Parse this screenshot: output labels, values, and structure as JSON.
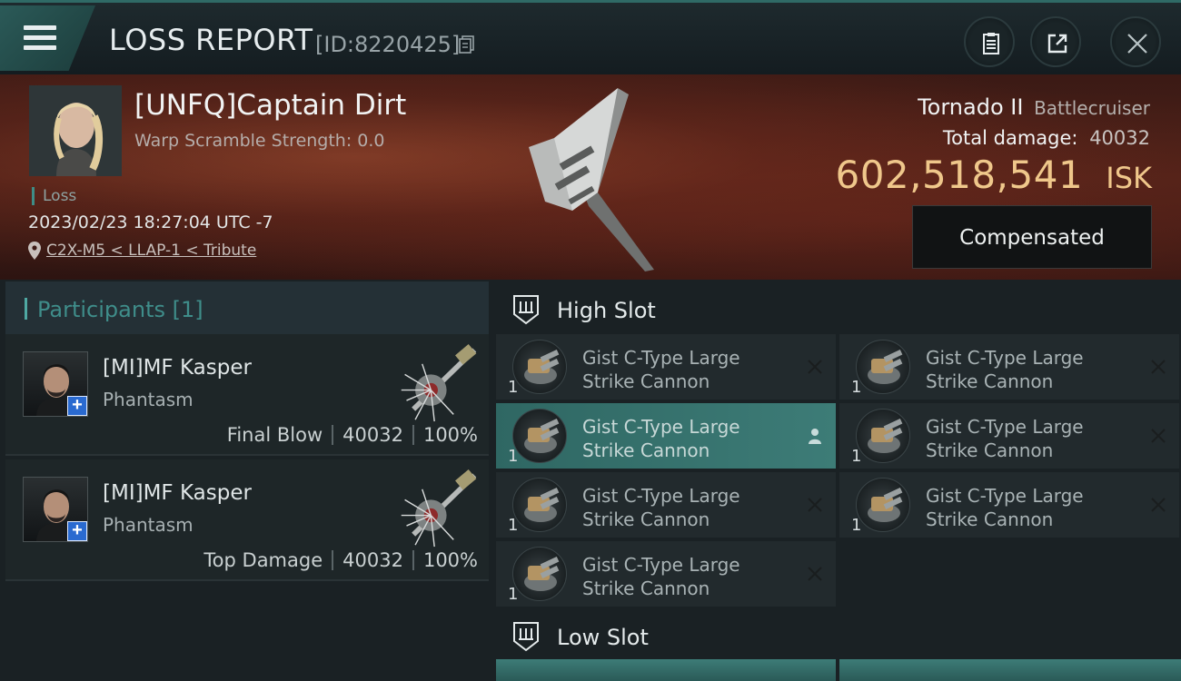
{
  "header": {
    "title": "LOSS REPORT",
    "report_id": "[ID:8220425]",
    "icons": [
      "menu-icon",
      "copy-icon",
      "clipboard-icon",
      "share-icon",
      "close-icon"
    ]
  },
  "victim": {
    "pilot_name": "[UNFQ]Captain Dirt",
    "warp_scramble": "Warp Scramble Strength: 0.0",
    "result_tag": "Loss",
    "datetime": "2023/02/23 18:27:04 UTC -7",
    "location": "C2X-M5 < LLAP-1 < Tribute",
    "ship_name": "Tornado II",
    "ship_class": "Battlecruiser",
    "total_damage_label": "Total damage:",
    "total_damage_value": "40032",
    "isk_amount": "602,518,541",
    "isk_unit": "ISK",
    "compensated_label": "Compensated"
  },
  "participants": {
    "header": "Participants [1]",
    "rows": [
      {
        "name": "[MI]MF Kasper",
        "ship": "Phantasm",
        "role": "Final Blow",
        "damage": "40032",
        "percent": "100%"
      },
      {
        "name": "[MI]MF Kasper",
        "ship": "Phantasm",
        "role": "Top Damage",
        "damage": "40032",
        "percent": "100%"
      }
    ]
  },
  "slots": {
    "high": {
      "label": "High Slot",
      "modules": [
        {
          "name": "Gist C-Type Large Strike Cannon",
          "qty": "1",
          "status": "destroyed"
        },
        {
          "name": "Gist C-Type Large Strike Cannon",
          "qty": "1",
          "status": "dropped"
        },
        {
          "name": "Gist C-Type Large Strike Cannon",
          "qty": "1",
          "status": "destroyed"
        },
        {
          "name": "Gist C-Type Large Strike Cannon",
          "qty": "1",
          "status": "destroyed"
        },
        {
          "name": "Gist C-Type Large Strike Cannon",
          "qty": "1",
          "status": "destroyed"
        },
        {
          "name": "Gist C-Type Large Strike Cannon",
          "qty": "1",
          "status": "destroyed"
        },
        {
          "name": "Gist C-Type Large Strike Cannon",
          "qty": "1",
          "status": "destroyed"
        }
      ]
    },
    "low": {
      "label": "Low Slot"
    }
  },
  "colors": {
    "accent_teal": "#3e8d86",
    "isk_gold": "#efc78b",
    "active_module": "#3d7c77"
  }
}
